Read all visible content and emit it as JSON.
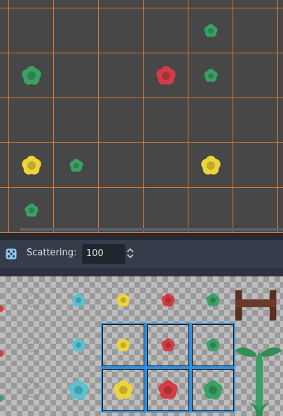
{
  "toolbar": {
    "scattering_label": "Scattering:",
    "scattering_value": "100",
    "dice_icon": "dice-icon",
    "spin_icon": "up-down-arrows-icon"
  },
  "colors": {
    "grid_line": "#e0793a",
    "selection": "#2d8fe0",
    "flower_green": "#3aa063",
    "flower_red": "#d43c45",
    "flower_yellow": "#ecd43a",
    "flower_cyan": "#56c3d3",
    "fence_brown": "#6b3a2a"
  },
  "map_items": [
    {
      "kind": "small",
      "color": "green",
      "col": 4,
      "row": 0
    },
    {
      "kind": "big",
      "color": "green",
      "col": 0,
      "row": 1
    },
    {
      "kind": "big",
      "color": "red",
      "col": 3,
      "row": 1
    },
    {
      "kind": "small",
      "color": "green",
      "col": 4,
      "row": 1
    },
    {
      "kind": "big",
      "color": "yellow",
      "col": 0,
      "row": 3
    },
    {
      "kind": "small",
      "color": "green",
      "col": 1,
      "row": 3
    },
    {
      "kind": "big",
      "color": "yellow",
      "col": 4,
      "row": 3
    },
    {
      "kind": "small",
      "color": "green",
      "col": 0,
      "row": 4
    }
  ],
  "palette_tiles": [
    {
      "kind": "outline-small",
      "color": "gray",
      "col": 0,
      "row": 0,
      "selected": false
    },
    {
      "kind": "small",
      "color": "cyan",
      "col": 1,
      "row": 0,
      "selected": false
    },
    {
      "kind": "small",
      "color": "yellow",
      "col": 2,
      "row": 0,
      "selected": false
    },
    {
      "kind": "small",
      "color": "red",
      "col": 3,
      "row": 0,
      "selected": false
    },
    {
      "kind": "small",
      "color": "green",
      "col": 4,
      "row": 0,
      "selected": false
    },
    {
      "kind": "outline-small",
      "color": "gray",
      "col": 0,
      "row": 1,
      "selected": false
    },
    {
      "kind": "small",
      "color": "cyan",
      "col": 1,
      "row": 1,
      "selected": false
    },
    {
      "kind": "small",
      "color": "yellow",
      "col": 2,
      "row": 1,
      "selected": true
    },
    {
      "kind": "small",
      "color": "red",
      "col": 3,
      "row": 1,
      "selected": true
    },
    {
      "kind": "small",
      "color": "green",
      "col": 4,
      "row": 1,
      "selected": true
    },
    {
      "kind": "outline-big",
      "color": "gray",
      "col": 0,
      "row": 2,
      "selected": false
    },
    {
      "kind": "big",
      "color": "cyan",
      "col": 1,
      "row": 2,
      "selected": false
    },
    {
      "kind": "big",
      "color": "yellow",
      "col": 2,
      "row": 2,
      "selected": true
    },
    {
      "kind": "big",
      "color": "red",
      "col": 3,
      "row": 2,
      "selected": true
    },
    {
      "kind": "big",
      "color": "green",
      "col": 4,
      "row": 2,
      "selected": true
    }
  ]
}
